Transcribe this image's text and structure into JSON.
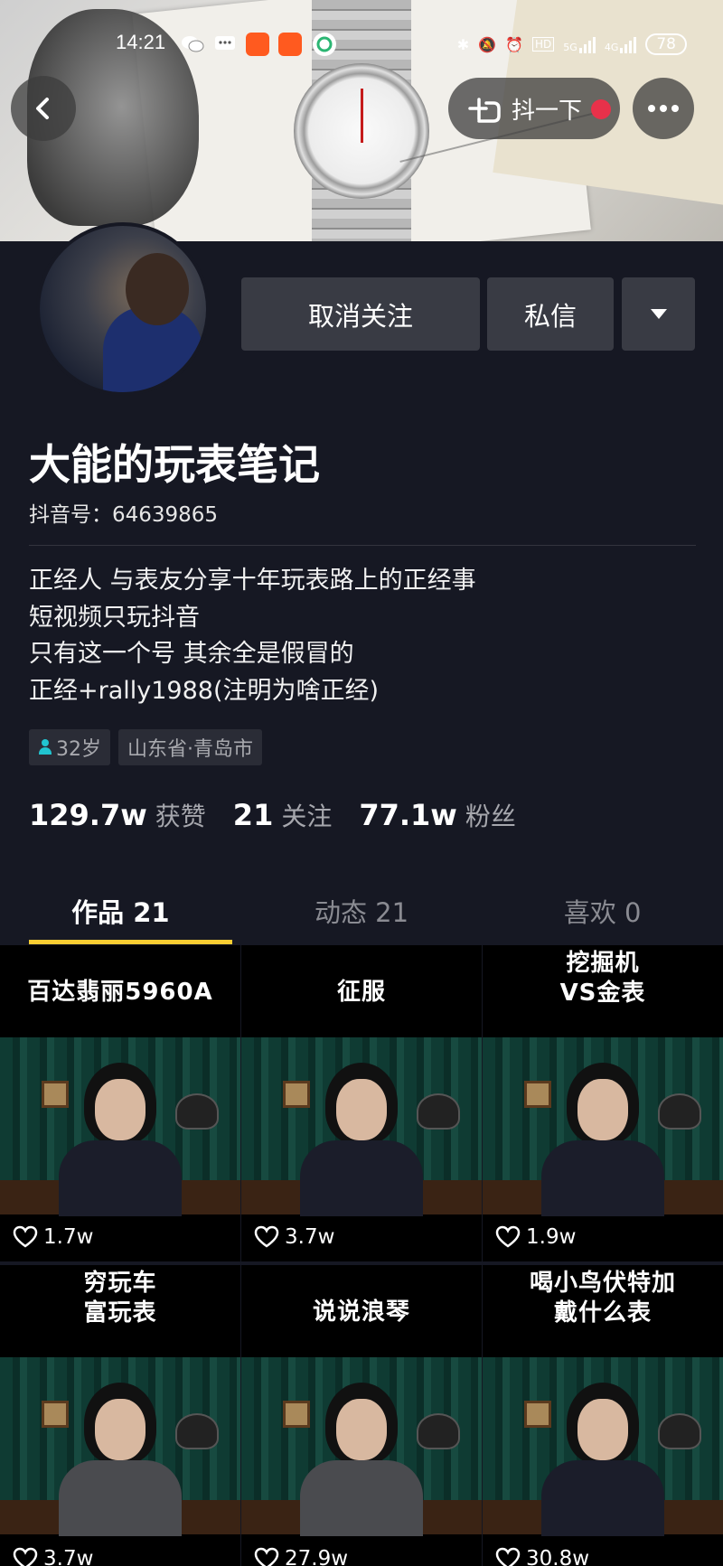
{
  "status_bar": {
    "time": "14:21",
    "battery": "78",
    "network_left": "5G",
    "network_right": "4G",
    "hd_label": "HD"
  },
  "top_bar": {
    "shake_label": "抖一下"
  },
  "profile": {
    "buttons": {
      "unfollow": "取消关注",
      "message": "私信"
    },
    "nickname": "大能的玩表笔记",
    "douyin_id": "抖音号：64639865",
    "bio": [
      "正经人 与表友分享十年玩表路上的正经事",
      "短视频只玩抖音",
      "只有这一个号 其余全是假冒的",
      "正经+rally1988(注明为啥正经)"
    ],
    "tags": {
      "age": "32岁",
      "location": "山东省·青岛市"
    },
    "stats": [
      {
        "value": "129.7w",
        "label": "获赞"
      },
      {
        "value": "21",
        "label": "关注"
      },
      {
        "value": "77.1w",
        "label": "粉丝"
      }
    ]
  },
  "tabs": [
    {
      "label": "作品 21",
      "active": true
    },
    {
      "label": "动态 21",
      "active": false
    },
    {
      "label": "喜欢 0",
      "active": false
    }
  ],
  "videos": [
    {
      "caption": "百达翡丽5960A",
      "likes": "1.7w"
    },
    {
      "caption": "征服",
      "likes": "3.7w"
    },
    {
      "caption": "挖掘机\nVS金表",
      "likes": "1.9w"
    },
    {
      "caption": "穷玩车\n富玩表",
      "likes": "3.7w"
    },
    {
      "caption": "说说浪琴",
      "likes": "27.9w"
    },
    {
      "caption": "喝小鸟伏特加\n戴什么表",
      "likes": "30.8w"
    }
  ],
  "colors": {
    "background": "#161823",
    "button": "#393b44",
    "tab_indicator": "#facd32",
    "tag_icon": "#21c4d0",
    "shake_dot": "#e8314a"
  }
}
